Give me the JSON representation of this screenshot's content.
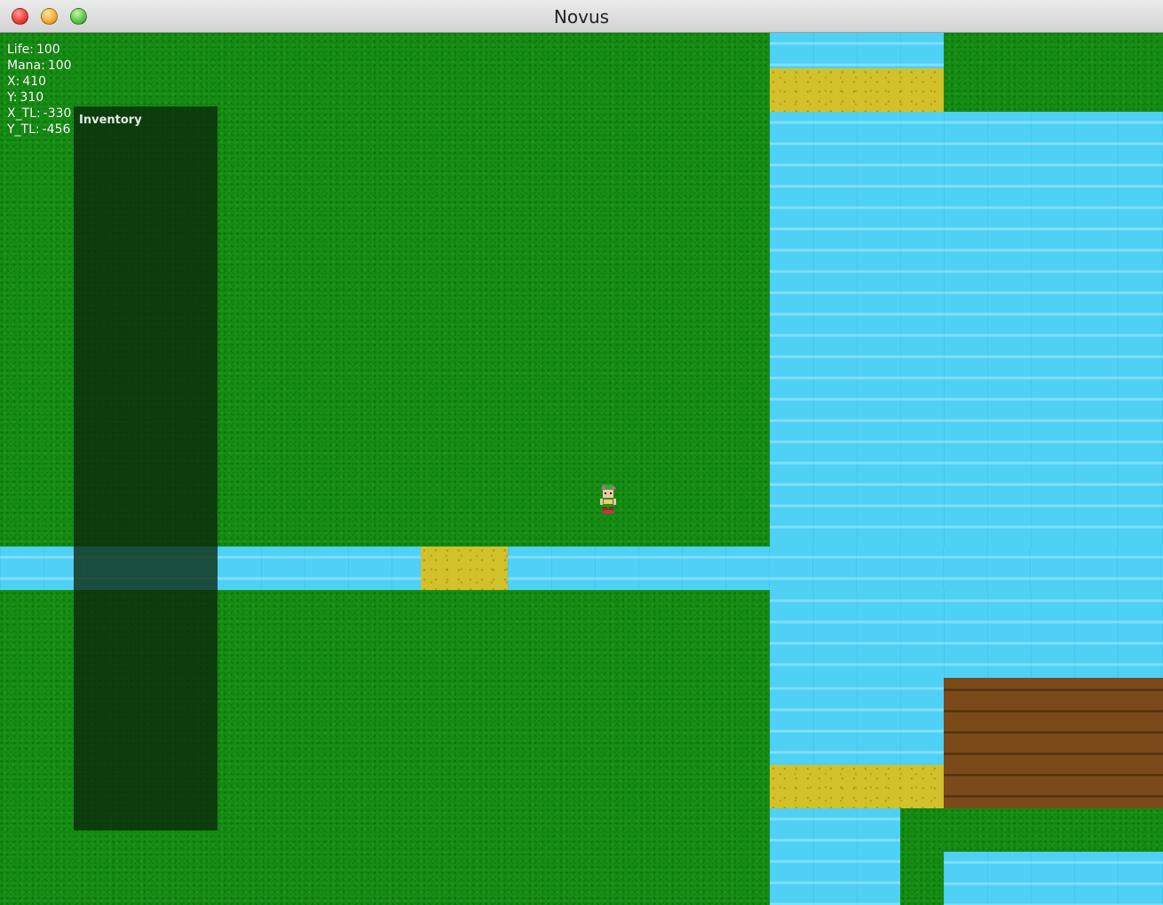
{
  "window": {
    "title": "Novus"
  },
  "hud": {
    "life_label": "Life:",
    "life_value": "100",
    "mana_label": "Mana:",
    "mana_value": "100",
    "x_label": "X:",
    "x_value": "410",
    "y_label": "Y:",
    "y_value": "310",
    "xtl_label": "X_TL:",
    "xtl_value": "-330",
    "ytl_label": "Y_TL:",
    "ytl_value": "-456"
  },
  "inventory": {
    "title": "Inventory"
  },
  "colors": {
    "grass": "#158e14",
    "water": "#4fd0f5",
    "sand": "#d2c12a",
    "dirt": "#7b4a1a",
    "inventory_panel": "#0a280a"
  },
  "icons": {
    "player": "player-sprite-icon"
  }
}
